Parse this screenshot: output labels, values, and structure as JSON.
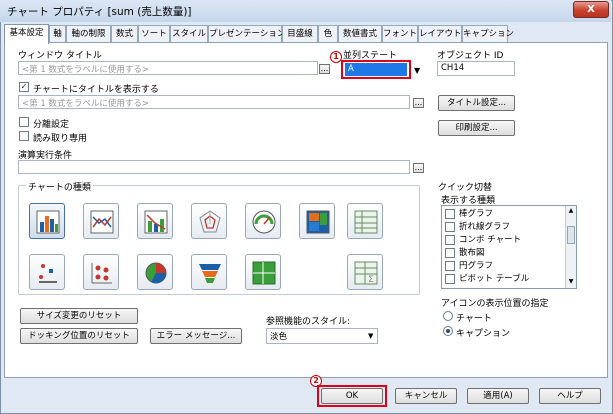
{
  "window": {
    "title": "チャート プロパティ [sum (売上数量)]",
    "close_label": "X"
  },
  "tabs": [
    {
      "label": "基本設定"
    },
    {
      "label": "軸"
    },
    {
      "label": "軸の制限"
    },
    {
      "label": "数式"
    },
    {
      "label": "ソート"
    },
    {
      "label": "スタイル"
    },
    {
      "label": "プレゼンテーション"
    },
    {
      "label": "目盛線"
    },
    {
      "label": "色"
    },
    {
      "label": "数値書式"
    },
    {
      "label": "フォント"
    },
    {
      "label": "レイアウト"
    },
    {
      "label": "キャプション"
    }
  ],
  "general": {
    "window_title_label": "ウィンドウ タイトル",
    "window_title_placeholder": "<第 1 数式をラベルに使用する>",
    "show_title_label": "チャートにタイトルを表示する",
    "show_title_checked": "✓",
    "chart_title_placeholder": "<第 1 数式をラベルに使用する>",
    "alternate_state_label": "並列ステート",
    "alternate_state_value": "A",
    "object_id_label": "オブジェクト ID",
    "object_id_value": "CH14",
    "title_settings_button": "タイトル設定...",
    "print_settings_button": "印刷設定...",
    "detach_label": "分離設定",
    "readonly_label": "読み取り専用",
    "calc_condition_label": "演算実行条件",
    "dots_label": "..."
  },
  "chart_types": {
    "label": "チャートの種類",
    "icons": [
      "bar-chart-icon",
      "line-chart-icon",
      "combo-chart-icon",
      "radar-chart-icon",
      "gauge-chart-icon",
      "block-chart-icon",
      "pivot-table-icon",
      "scatter-chart-icon",
      "grid-chart-icon",
      "pie-chart-icon",
      "funnel-chart-icon",
      "mekko-chart-icon",
      "straight-table-icon"
    ]
  },
  "quick_change": {
    "label": "クイック切替",
    "show_types_label": "表示する種類",
    "items": [
      {
        "label": "棒グラフ"
      },
      {
        "label": "折れ線グラフ"
      },
      {
        "label": "コンボ チャート"
      },
      {
        "label": "散布図"
      },
      {
        "label": "円グラフ"
      },
      {
        "label": "ピボット テーブル"
      }
    ]
  },
  "icon_position": {
    "label": "アイコンの表示位置の指定",
    "options": [
      {
        "label": "チャート",
        "selected": false
      },
      {
        "label": "キャプション",
        "selected": true
      }
    ]
  },
  "reset": {
    "size_reset_button": "サイズ変更のリセット",
    "docking_reset_button": "ドッキング位置のリセット",
    "error_message_button": "エラー メッセージ..."
  },
  "reference_style": {
    "label": "参照機能のスタイル:",
    "value": "淡色"
  },
  "annotations": {
    "marker1": "1",
    "marker2": "2"
  },
  "footer": {
    "ok_button": "OK",
    "cancel_button": "キャンセル",
    "apply_button": "適用(A)",
    "help_button": "ヘルプ"
  },
  "colors": {
    "highlight_red": "#e0001a",
    "selected_field_blue": "#1e78e8"
  }
}
